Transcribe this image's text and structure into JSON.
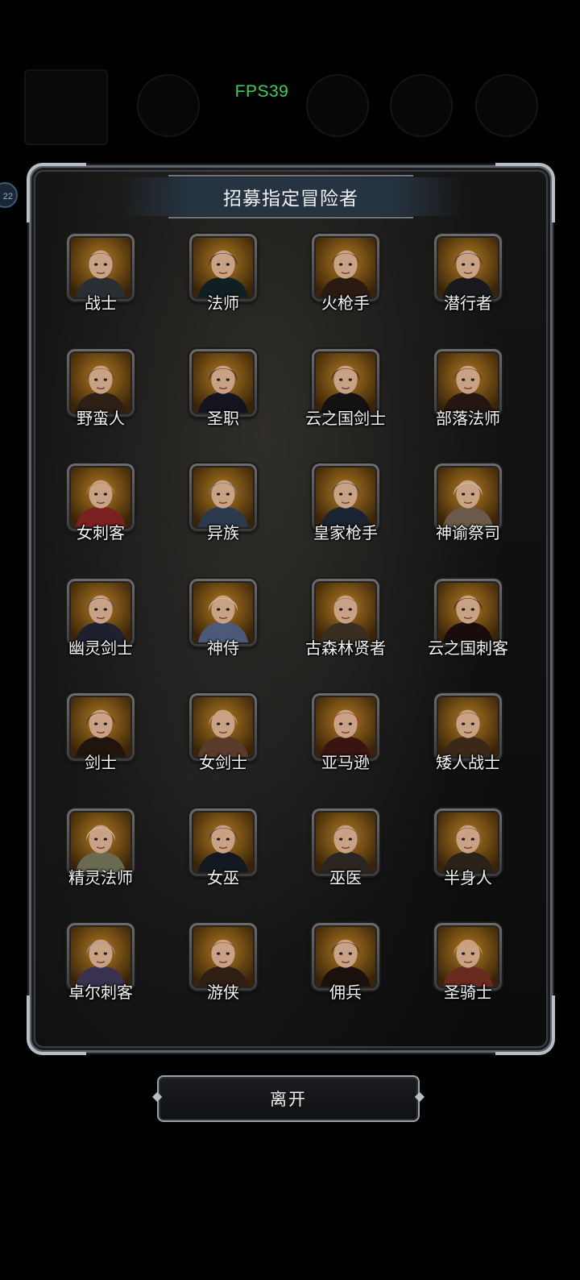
{
  "hud": {
    "fps": "FPS39",
    "side_badge": "22"
  },
  "dialog": {
    "title": "招募指定冒险者",
    "leave_label": "离开"
  },
  "colors": {
    "fps": "#39d15a",
    "frame": "#5d636b",
    "portrait_bg": "#8a5a14",
    "title_band": "#263442"
  },
  "classes": [
    {
      "name": "战士",
      "icon": "helmet-knight-portrait"
    },
    {
      "name": "法师",
      "icon": "hooded-mage-portrait"
    },
    {
      "name": "火枪手",
      "icon": "musketeer-portrait"
    },
    {
      "name": "潜行者",
      "icon": "masked-rogue-portrait"
    },
    {
      "name": "野蛮人",
      "icon": "barbarian-portrait"
    },
    {
      "name": "圣职",
      "icon": "priestess-portrait"
    },
    {
      "name": "云之国剑士",
      "icon": "wide-hat-swordsman-portrait"
    },
    {
      "name": "部落法师",
      "icon": "tribal-mage-portrait"
    },
    {
      "name": "女刺客",
      "icon": "blonde-assassin-portrait"
    },
    {
      "name": "异族",
      "icon": "blue-beast-portrait"
    },
    {
      "name": "皇家枪手",
      "icon": "royal-gunner-portrait"
    },
    {
      "name": "神谕祭司",
      "icon": "oracle-priest-portrait"
    },
    {
      "name": "幽灵剑士",
      "icon": "ghost-swordsman-portrait"
    },
    {
      "name": "神侍",
      "icon": "white-hair-acolyte-portrait"
    },
    {
      "name": "古森林贤者",
      "icon": "forest-sage-portrait"
    },
    {
      "name": "云之国刺客",
      "icon": "wide-hat-assassin-portrait"
    },
    {
      "name": "剑士",
      "icon": "bearded-swordsman-portrait"
    },
    {
      "name": "女剑士",
      "icon": "swordswoman-portrait"
    },
    {
      "name": "亚马逊",
      "icon": "amazon-portrait"
    },
    {
      "name": "矮人战士",
      "icon": "dwarf-warrior-portrait"
    },
    {
      "name": "精灵法师",
      "icon": "elf-mage-portrait"
    },
    {
      "name": "女巫",
      "icon": "witch-portrait"
    },
    {
      "name": "巫医",
      "icon": "skull-witch-doctor-portrait"
    },
    {
      "name": "半身人",
      "icon": "halfling-portrait"
    },
    {
      "name": "卓尔刺客",
      "icon": "drow-assassin-portrait"
    },
    {
      "name": "游侠",
      "icon": "ranger-portrait"
    },
    {
      "name": "佣兵",
      "icon": "mercenary-portrait"
    },
    {
      "name": "圣骑士",
      "icon": "paladin-portrait"
    }
  ]
}
